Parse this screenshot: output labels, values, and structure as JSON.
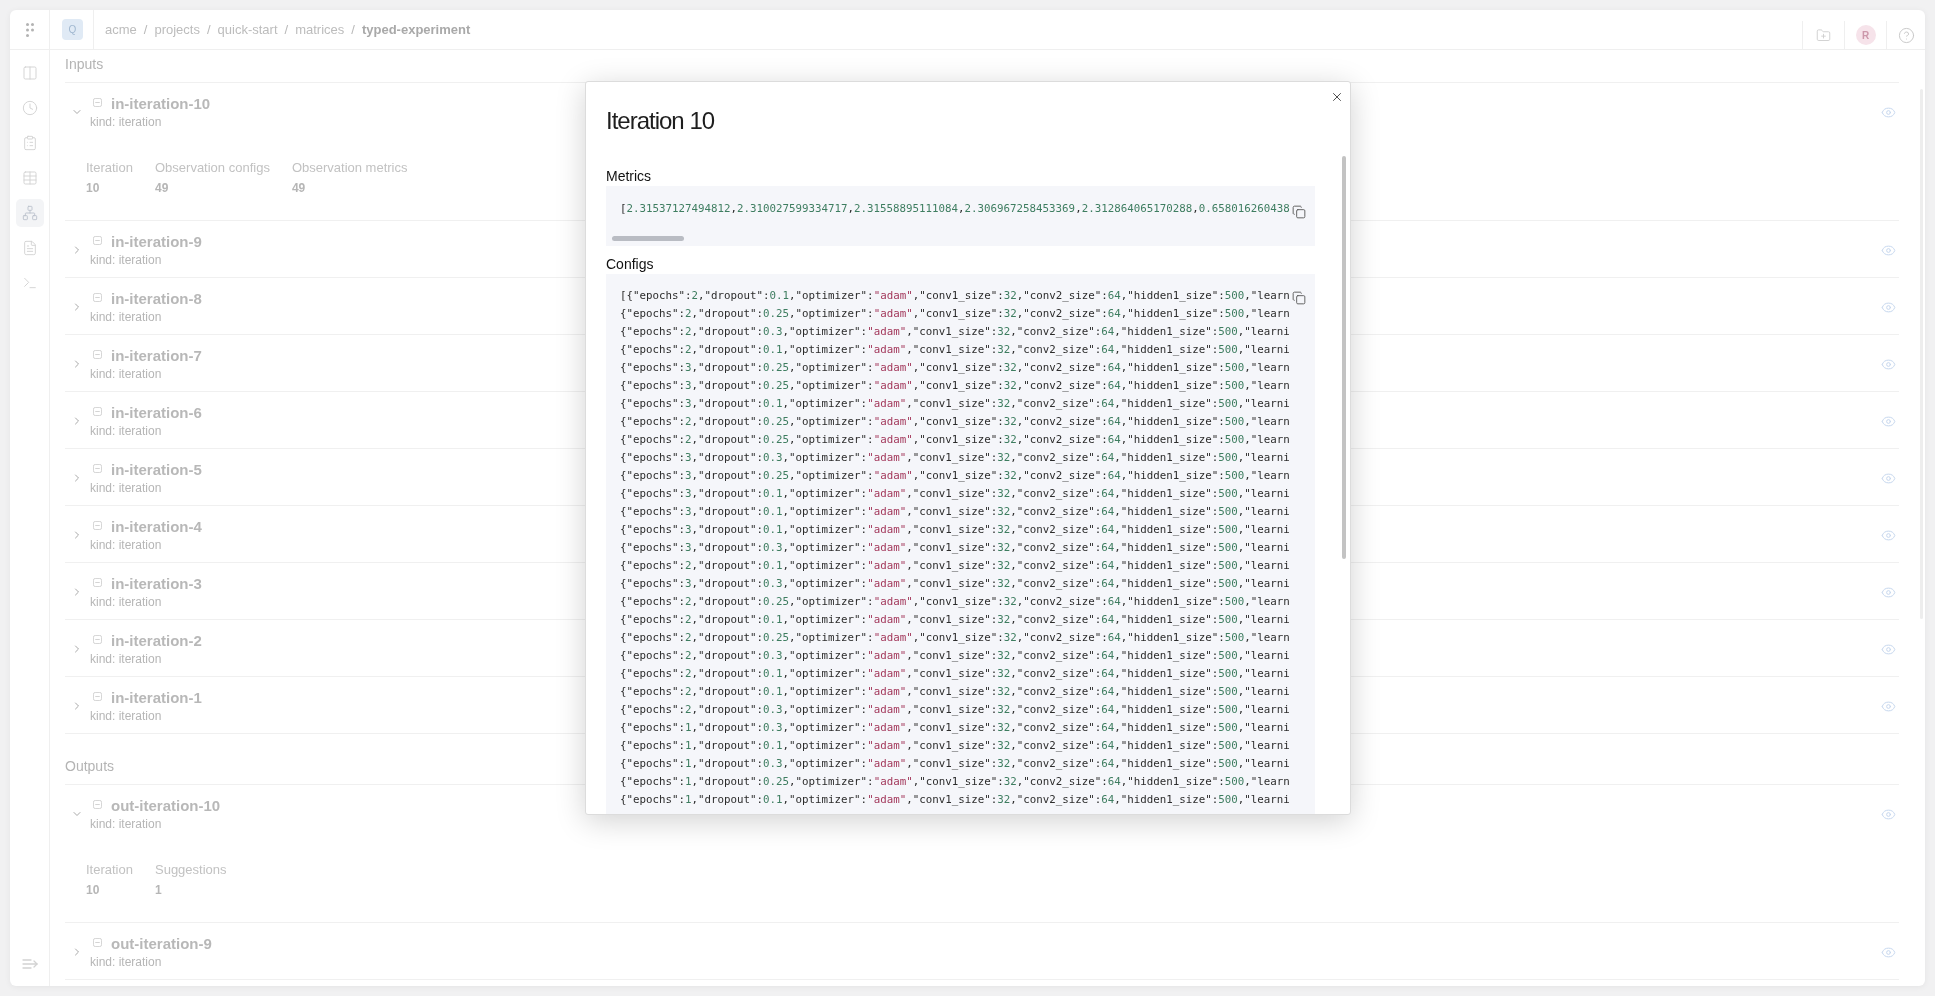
{
  "topbar": {
    "logo": "Q",
    "breadcrumbs": [
      {
        "kind": "link",
        "label": "acme"
      },
      {
        "kind": "separator",
        "label": "/"
      },
      {
        "kind": "link",
        "label": "projects"
      },
      {
        "kind": "separator",
        "label": "/"
      },
      {
        "kind": "link",
        "label": "quick-start"
      },
      {
        "kind": "separator",
        "label": "/"
      },
      {
        "kind": "link",
        "label": "matrices"
      },
      {
        "kind": "separator",
        "label": "/"
      },
      {
        "kind": "current",
        "label": "typed-experiment"
      }
    ],
    "avatar": "R"
  },
  "sidebar": {
    "items": [
      {
        "selected": false
      },
      {
        "selected": false
      },
      {
        "selected": false
      },
      {
        "selected": false
      },
      {
        "selected": true
      },
      {
        "selected": false
      },
      {
        "selected": false
      }
    ]
  },
  "sections": [
    {
      "title": "Inputs",
      "rows": [
        {
          "title": "in-iteration-10",
          "subtitle": "kind: iteration",
          "expanded": true,
          "details": [
            {
              "label": "Iteration",
              "value": "10"
            },
            {
              "label": "Observation configs",
              "value": "49"
            },
            {
              "label": "Observation metrics",
              "value": "49"
            }
          ]
        },
        {
          "title": "in-iteration-9",
          "subtitle": "kind: iteration",
          "expanded": false
        },
        {
          "title": "in-iteration-8",
          "subtitle": "kind: iteration",
          "expanded": false
        },
        {
          "title": "in-iteration-7",
          "subtitle": "kind: iteration",
          "expanded": false
        },
        {
          "title": "in-iteration-6",
          "subtitle": "kind: iteration",
          "expanded": false
        },
        {
          "title": "in-iteration-5",
          "subtitle": "kind: iteration",
          "expanded": false
        },
        {
          "title": "in-iteration-4",
          "subtitle": "kind: iteration",
          "expanded": false
        },
        {
          "title": "in-iteration-3",
          "subtitle": "kind: iteration",
          "expanded": false
        },
        {
          "title": "in-iteration-2",
          "subtitle": "kind: iteration",
          "expanded": false
        },
        {
          "title": "in-iteration-1",
          "subtitle": "kind: iteration",
          "expanded": false
        }
      ]
    },
    {
      "title": "Outputs",
      "rows": [
        {
          "title": "out-iteration-10",
          "subtitle": "kind: iteration",
          "expanded": true,
          "details": [
            {
              "label": "Iteration",
              "value": "10"
            },
            {
              "label": "Suggestions",
              "value": "1"
            }
          ]
        },
        {
          "title": "out-iteration-9",
          "subtitle": "kind: iteration",
          "expanded": false
        }
      ]
    }
  ],
  "dialog": {
    "title": "Iteration 10",
    "sections": [
      {
        "kind": "inline",
        "label": "Metrics",
        "lines": [
          "[2.31537127494812,2.310027599334717,2.31558895111084,2.306967258453369,2.312864065170288,0.658016260438"
        ]
      },
      {
        "kind": "block",
        "label": "Configs",
        "lines": [
          "[{\"epochs\":2,\"dropout\":0.1,\"optimizer\":\"adam\",\"conv1_size\":32,\"conv2_size\":64,\"hidden1_size\":500,\"learn",
          "{\"epochs\":2,\"dropout\":0.25,\"optimizer\":\"adam\",\"conv1_size\":32,\"conv2_size\":64,\"hidden1_size\":500,\"learn",
          "{\"epochs\":2,\"dropout\":0.3,\"optimizer\":\"adam\",\"conv1_size\":32,\"conv2_size\":64,\"hidden1_size\":500,\"learni",
          "{\"epochs\":2,\"dropout\":0.1,\"optimizer\":\"adam\",\"conv1_size\":32,\"conv2_size\":64,\"hidden1_size\":500,\"learni",
          "{\"epochs\":3,\"dropout\":0.25,\"optimizer\":\"adam\",\"conv1_size\":32,\"conv2_size\":64,\"hidden1_size\":500,\"learn",
          "{\"epochs\":3,\"dropout\":0.25,\"optimizer\":\"adam\",\"conv1_size\":32,\"conv2_size\":64,\"hidden1_size\":500,\"learn",
          "{\"epochs\":3,\"dropout\":0.1,\"optimizer\":\"adam\",\"conv1_size\":32,\"conv2_size\":64,\"hidden1_size\":500,\"learni",
          "{\"epochs\":2,\"dropout\":0.25,\"optimizer\":\"adam\",\"conv1_size\":32,\"conv2_size\":64,\"hidden1_size\":500,\"learn",
          "{\"epochs\":2,\"dropout\":0.25,\"optimizer\":\"adam\",\"conv1_size\":32,\"conv2_size\":64,\"hidden1_size\":500,\"learn",
          "{\"epochs\":3,\"dropout\":0.3,\"optimizer\":\"adam\",\"conv1_size\":32,\"conv2_size\":64,\"hidden1_size\":500,\"learni",
          "{\"epochs\":3,\"dropout\":0.25,\"optimizer\":\"adam\",\"conv1_size\":32,\"conv2_size\":64,\"hidden1_size\":500,\"learn",
          "{\"epochs\":3,\"dropout\":0.1,\"optimizer\":\"adam\",\"conv1_size\":32,\"conv2_size\":64,\"hidden1_size\":500,\"learni",
          "{\"epochs\":3,\"dropout\":0.1,\"optimizer\":\"adam\",\"conv1_size\":32,\"conv2_size\":64,\"hidden1_size\":500,\"learni",
          "{\"epochs\":3,\"dropout\":0.1,\"optimizer\":\"adam\",\"conv1_size\":32,\"conv2_size\":64,\"hidden1_size\":500,\"learni",
          "{\"epochs\":3,\"dropout\":0.3,\"optimizer\":\"adam\",\"conv1_size\":32,\"conv2_size\":64,\"hidden1_size\":500,\"learni",
          "{\"epochs\":2,\"dropout\":0.1,\"optimizer\":\"adam\",\"conv1_size\":32,\"conv2_size\":64,\"hidden1_size\":500,\"learni",
          "{\"epochs\":3,\"dropout\":0.3,\"optimizer\":\"adam\",\"conv1_size\":32,\"conv2_size\":64,\"hidden1_size\":500,\"learni",
          "{\"epochs\":2,\"dropout\":0.25,\"optimizer\":\"adam\",\"conv1_size\":32,\"conv2_size\":64,\"hidden1_size\":500,\"learn",
          "{\"epochs\":2,\"dropout\":0.1,\"optimizer\":\"adam\",\"conv1_size\":32,\"conv2_size\":64,\"hidden1_size\":500,\"learni",
          "{\"epochs\":2,\"dropout\":0.25,\"optimizer\":\"adam\",\"conv1_size\":32,\"conv2_size\":64,\"hidden1_size\":500,\"learn",
          "{\"epochs\":2,\"dropout\":0.3,\"optimizer\":\"adam\",\"conv1_size\":32,\"conv2_size\":64,\"hidden1_size\":500,\"learni",
          "{\"epochs\":2,\"dropout\":0.1,\"optimizer\":\"adam\",\"conv1_size\":32,\"conv2_size\":64,\"hidden1_size\":500,\"learni",
          "{\"epochs\":2,\"dropout\":0.1,\"optimizer\":\"adam\",\"conv1_size\":32,\"conv2_size\":64,\"hidden1_size\":500,\"learni",
          "{\"epochs\":2,\"dropout\":0.3,\"optimizer\":\"adam\",\"conv1_size\":32,\"conv2_size\":64,\"hidden1_size\":500,\"learni",
          "{\"epochs\":1,\"dropout\":0.3,\"optimizer\":\"adam\",\"conv1_size\":32,\"conv2_size\":64,\"hidden1_size\":500,\"learni",
          "{\"epochs\":1,\"dropout\":0.1,\"optimizer\":\"adam\",\"conv1_size\":32,\"conv2_size\":64,\"hidden1_size\":500,\"learni",
          "{\"epochs\":1,\"dropout\":0.3,\"optimizer\":\"adam\",\"conv1_size\":32,\"conv2_size\":64,\"hidden1_size\":500,\"learni",
          "{\"epochs\":1,\"dropout\":0.25,\"optimizer\":\"adam\",\"conv1_size\":32,\"conv2_size\":64,\"hidden1_size\":500,\"learn",
          "{\"epochs\":1,\"dropout\":0.1,\"optimizer\":\"adam\",\"conv1_size\":32,\"conv2_size\":64,\"hidden1_size\":500,\"learni"
        ]
      }
    ]
  }
}
